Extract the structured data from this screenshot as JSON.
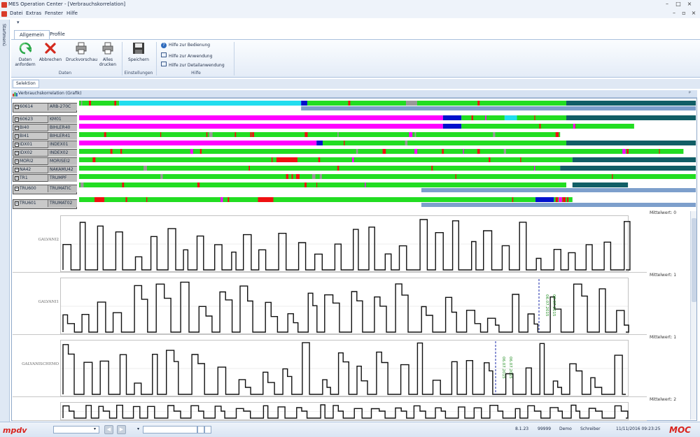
{
  "window": {
    "title": "MES Operation Center - [Verbrauchskorrelation]"
  },
  "menu": [
    "Datei",
    "Extras",
    "Fenster",
    "Hilfe"
  ],
  "leftstrip": {
    "label": "Startmenü"
  },
  "ribbon": {
    "tabs": [
      "Allgemein",
      "Profile"
    ],
    "buttons": {
      "daten_anfordern": "Daten anfordern",
      "abbrechen": "Abbrechen",
      "druckvorschau": "Druckvorschau",
      "alles_drucken": "Alles drucken",
      "speichern": "Speichern"
    },
    "groups": {
      "daten": "Daten",
      "einstellungen": "Einstellungen",
      "hilfe": "Hilfe"
    },
    "help_items": [
      "Hilfe zur Bedienung",
      "Hilfe zur Anwendung",
      "Hilfe zur Detailanwendung"
    ]
  },
  "selection_button": "Selektion",
  "panel": {
    "title": "Verbrauchskorrelation (Grafik)",
    "pin": "ᵖ"
  },
  "gantt_rows": [
    {
      "id": "60614",
      "name": "ARB-270C"
    },
    {
      "id": "60623",
      "name": "KM01"
    },
    {
      "id": "BI40",
      "name": "BIHLER40"
    },
    {
      "id": "BI41",
      "name": "BIHLER41"
    },
    {
      "id": "IDX01",
      "name": "INDEX01"
    },
    {
      "id": "IDX02",
      "name": "INDEX02"
    },
    {
      "id": "MORI2",
      "name": "MORISEI2"
    },
    {
      "id": "NA42",
      "name": "NAKAMU42"
    },
    {
      "id": "TR1",
      "name": "TRUMPF"
    },
    {
      "id": "TRU600",
      "name": "TRUMATIC"
    },
    {
      "id": "TRU601",
      "name": "TRUMAT02"
    }
  ],
  "gantt_colors": {
    "run": "#22dd22",
    "setup": "#ff00ff",
    "fault": "#ee1111",
    "idle": "#115e66",
    "plan": "#7d9fcc",
    "cyan": "#22ddee",
    "blue": "#0011cc",
    "grey": "#999999"
  },
  "curves": [
    {
      "label": "GALVANI2",
      "mittelwert": "Mittelwert: 0"
    },
    {
      "label": "GALVANI1",
      "mittelwert": "Mittelwert: 1",
      "annotation": [
        "06.07.2015",
        "06.07.2015"
      ]
    },
    {
      "label": "GALVANISCHEMO",
      "mittelwert": "Mittelwert: 1",
      "annotation": [
        "06.07.2015",
        "06.07.2015"
      ]
    },
    {
      "label": "",
      "mittelwert": "Mittelwert: 2"
    }
  ],
  "status": {
    "version": "8.1.23",
    "number": "99999",
    "mode": "Demo",
    "user": "Schreiber",
    "datetime": "11/11/2016 09:23:25",
    "logo_left": "mpdv",
    "logo_right": "MOC"
  }
}
